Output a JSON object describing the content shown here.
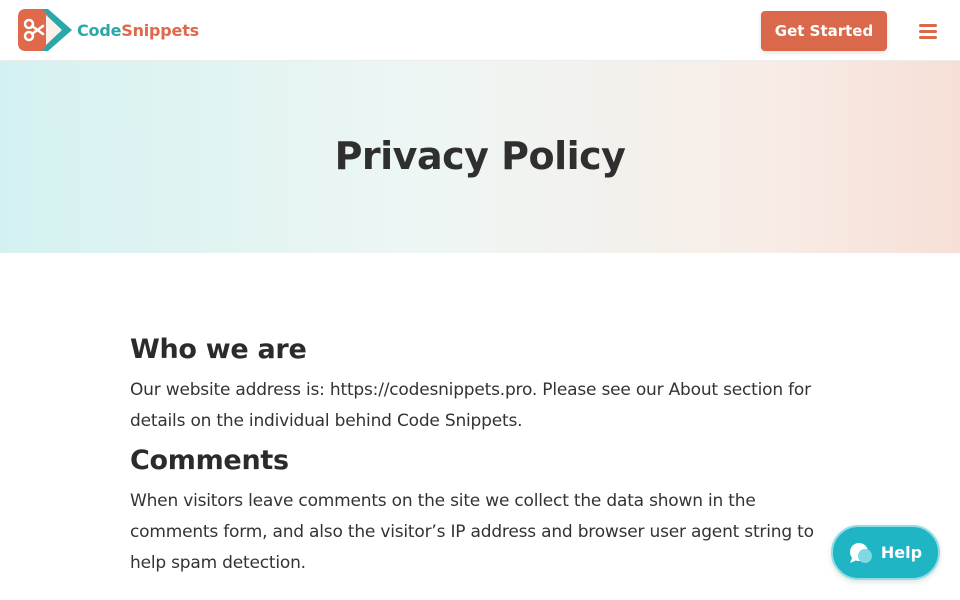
{
  "header": {
    "logo_text_code": "Code",
    "logo_text_snippets": "Snippets",
    "cta_label": "Get Started",
    "menu_icon": "hamburger-menu-icon"
  },
  "hero": {
    "title": "Privacy Policy"
  },
  "content": {
    "sections": [
      {
        "heading": "Who we are",
        "body": "Our website address is: https://codesnippets.pro. Please see our About section for details on the individual behind Code Snippets."
      },
      {
        "heading": "Comments",
        "body": "When visitors leave comments on the site we collect the data shown in the comments form, and also the visitor’s IP address and browser user agent string to help spam detection."
      }
    ]
  },
  "help_widget": {
    "label": "Help",
    "icon": "chat-bubble-icon"
  },
  "colors": {
    "brand_orange": "#d9694a",
    "brand_teal": "#2aa8a8",
    "help_teal": "#1fb5c4"
  }
}
